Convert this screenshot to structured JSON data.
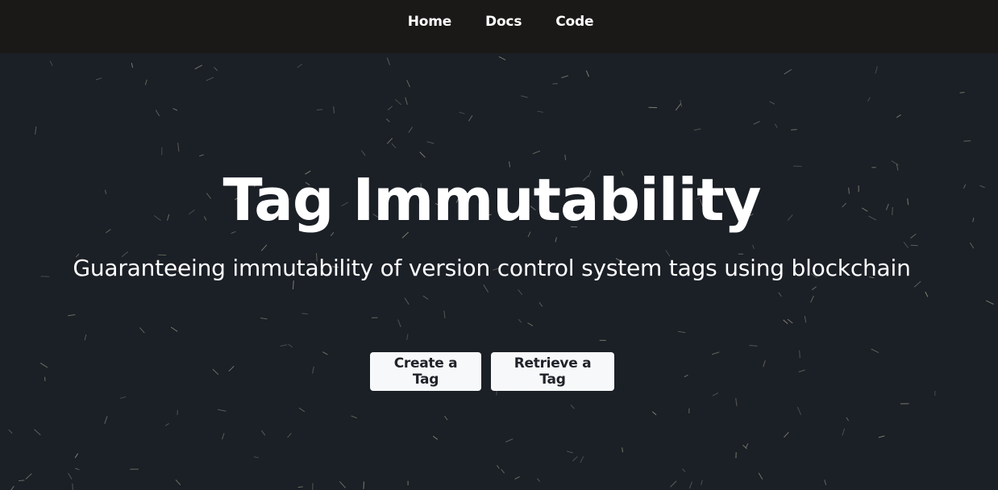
{
  "nav": {
    "items": [
      {
        "label": "Home"
      },
      {
        "label": "Docs"
      },
      {
        "label": "Code"
      }
    ]
  },
  "hero": {
    "title": "Tag Immutability",
    "subtitle": "Guaranteeing immutability of version control system tags using blockchain",
    "buttons": {
      "create_label": "Create a Tag",
      "retrieve_label": "Retrieve a Tag"
    }
  },
  "colors": {
    "navbar_bg": "#1b1917",
    "hero_bg": "#1b1f26",
    "particle": "#9a9a86",
    "button_bg": "#f7f8fa",
    "button_text": "#1f2329"
  }
}
